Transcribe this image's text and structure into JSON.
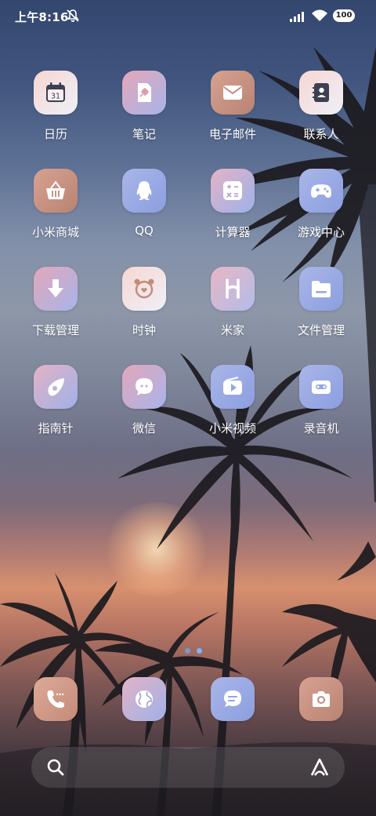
{
  "status_bar": {
    "time": "上午8:16",
    "battery": "100",
    "icons": [
      "mute-icon",
      "signal-icon",
      "wifi-icon",
      "battery-icon"
    ]
  },
  "apps": [
    {
      "label": "日历",
      "icon": "calendar-icon",
      "day": "31"
    },
    {
      "label": "笔记",
      "icon": "notes-icon"
    },
    {
      "label": "电子邮件",
      "icon": "email-icon"
    },
    {
      "label": "联系人",
      "icon": "contacts-icon"
    },
    {
      "label": "小米商城",
      "icon": "basket-icon"
    },
    {
      "label": "QQ",
      "icon": "qq-penguin-icon"
    },
    {
      "label": "计算器",
      "icon": "calculator-icon"
    },
    {
      "label": "游戏中心",
      "icon": "gamepad-icon"
    },
    {
      "label": "下载管理",
      "icon": "download-icon"
    },
    {
      "label": "时钟",
      "icon": "alarm-clock-icon"
    },
    {
      "label": "米家",
      "icon": "mijia-icon"
    },
    {
      "label": "文件管理",
      "icon": "folder-icon"
    },
    {
      "label": "指南针",
      "icon": "compass-icon"
    },
    {
      "label": "微信",
      "icon": "chat-bubble-icon"
    },
    {
      "label": "小米视频",
      "icon": "video-icon"
    },
    {
      "label": "录音机",
      "icon": "recorder-icon"
    }
  ],
  "dock": [
    {
      "icon": "phone-icon"
    },
    {
      "icon": "browser-globe-icon"
    },
    {
      "icon": "messages-icon"
    },
    {
      "icon": "camera-icon"
    }
  ],
  "page_indicator": {
    "pages": 2,
    "current": 1
  },
  "search_bar": {
    "icons": [
      "search-icon",
      "assistant-icon"
    ]
  },
  "colors": {
    "icon_white": "#ffffff",
    "label_text": "#ffffff",
    "dot_active": "#6fa8ff",
    "dot_inactive": "#6fa8ff"
  }
}
